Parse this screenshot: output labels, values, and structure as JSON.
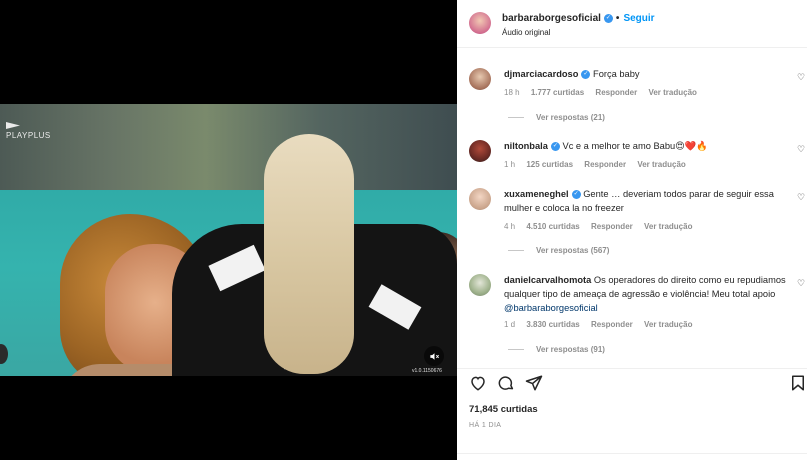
{
  "header": {
    "username": "barbaraborgesoficial",
    "follow_label": "Seguir",
    "subtitle": "Áudio original"
  },
  "video": {
    "brand": "PLAYPLUS",
    "mute_icon": "speaker-muted-icon",
    "watermark": "v1.0.1150676"
  },
  "comments": [
    {
      "username": "djmarciacardoso",
      "text": "Força baby",
      "time": "18 h",
      "likes": "1.777 curtidas",
      "reply_label": "Responder",
      "translate_label": "Ver tradução",
      "replies": "Ver respostas (21)"
    },
    {
      "username": "niltonbala",
      "text": "Vc e a melhor te amo Babu😍❤️🔥",
      "time": "1 h",
      "likes": "125 curtidas",
      "reply_label": "Responder",
      "translate_label": "Ver tradução",
      "replies": ""
    },
    {
      "username": "xuxameneghel",
      "text": "Gente … deveriam todos parar de seguir essa mulher e coloca la no freezer",
      "time": "4 h",
      "likes": "4.510 curtidas",
      "reply_label": "Responder",
      "translate_label": "Ver tradução",
      "replies": "Ver respostas (567)"
    },
    {
      "username": "danielcarvalhomota",
      "text": "Os operadores do direito como eu repudiamos qualquer tipo de ameaça de agressão e violência! Meu total apoio",
      "mention": "@barbaraborgesoficial",
      "time": "1 d",
      "likes": "3.830 curtidas",
      "reply_label": "Responder",
      "translate_label": "Ver tradução",
      "replies": "Ver respostas (91)"
    }
  ],
  "actions": {
    "like_icon": "heart-icon",
    "comment_icon": "comment-icon",
    "share_icon": "send-icon",
    "save_icon": "bookmark-icon",
    "likes": "71,845 curtidas",
    "time": "HÁ 1 DIA"
  },
  "colors": {
    "accent": "#0095f6",
    "verified": "#3897f0",
    "muted_text": "#8e8e8e",
    "text": "#262626"
  }
}
